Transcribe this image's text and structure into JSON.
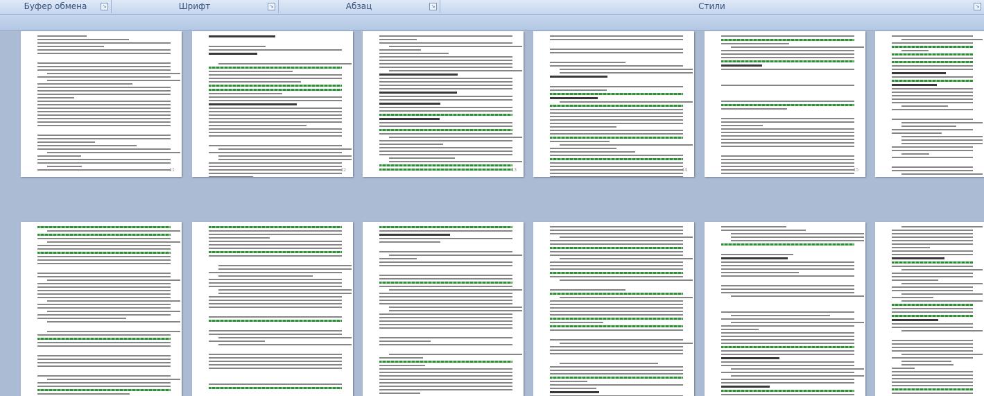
{
  "ribbon": {
    "groups": [
      {
        "label": "Буфер обмена",
        "launcher": "dialog-launcher-icon"
      },
      {
        "label": "Шрифт",
        "launcher": "dialog-launcher-icon"
      },
      {
        "label": "Абзац",
        "launcher": "dialog-launcher-icon"
      },
      {
        "label": "Стили",
        "launcher": "dialog-launcher-icon"
      }
    ]
  },
  "pages": [
    {
      "number": "11"
    },
    {
      "number": "12"
    },
    {
      "number": "13"
    },
    {
      "number": "14"
    },
    {
      "number": "15"
    },
    {
      "number": ""
    },
    {
      "number": ""
    },
    {
      "number": ""
    },
    {
      "number": ""
    },
    {
      "number": ""
    },
    {
      "number": ""
    },
    {
      "number": ""
    }
  ],
  "colors": {
    "workspace": "#abbbd3",
    "ribbon": "#c5d6ee",
    "spellcheck": "#2e8f3a"
  }
}
